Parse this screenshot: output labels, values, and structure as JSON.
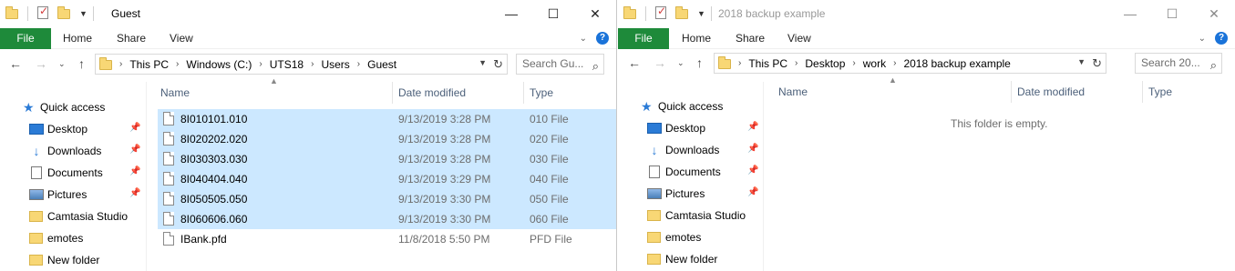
{
  "left_window": {
    "title": "Guest",
    "controls": {
      "minimize": "—",
      "maximize": "☐",
      "close": "✕"
    },
    "ribbon_tabs": [
      "File",
      "Home",
      "Share",
      "View"
    ],
    "address": {
      "crumbs": [
        "This PC",
        "Windows (C:)",
        "UTS18",
        "Users",
        "Guest"
      ]
    },
    "search_placeholder": "Search Gu...",
    "nav": {
      "quick_access": "Quick access",
      "items": [
        {
          "label": "Desktop",
          "icon": "desktop-icon",
          "pinned": true
        },
        {
          "label": "Downloads",
          "icon": "downloads-icon",
          "pinned": true
        },
        {
          "label": "Documents",
          "icon": "documents-icon",
          "pinned": true
        },
        {
          "label": "Pictures",
          "icon": "pictures-icon",
          "pinned": true
        },
        {
          "label": "Camtasia Studio",
          "icon": "folder-icon",
          "pinned": false
        },
        {
          "label": "emotes",
          "icon": "folder-icon",
          "pinned": false
        },
        {
          "label": "New folder",
          "icon": "folder-icon",
          "pinned": false
        }
      ]
    },
    "columns": {
      "name": "Name",
      "date": "Date modified",
      "type": "Type"
    },
    "files": [
      {
        "name": "8I010101.010",
        "date": "9/13/2019 3:28 PM",
        "type": "010 File",
        "selected": true
      },
      {
        "name": "8I020202.020",
        "date": "9/13/2019 3:28 PM",
        "type": "020 File",
        "selected": true
      },
      {
        "name": "8I030303.030",
        "date": "9/13/2019 3:28 PM",
        "type": "030 File",
        "selected": true
      },
      {
        "name": "8I040404.040",
        "date": "9/13/2019 3:29 PM",
        "type": "040 File",
        "selected": true
      },
      {
        "name": "8I050505.050",
        "date": "9/13/2019 3:30 PM",
        "type": "050 File",
        "selected": true
      },
      {
        "name": "8I060606.060",
        "date": "9/13/2019 3:30 PM",
        "type": "060 File",
        "selected": true
      },
      {
        "name": "IBank.pfd",
        "date": "11/8/2018 5:50 PM",
        "type": "PFD File",
        "selected": false
      }
    ]
  },
  "right_window": {
    "title": "2018 backup example",
    "controls": {
      "minimize": "—",
      "maximize": "☐",
      "close": "✕"
    },
    "ribbon_tabs": [
      "File",
      "Home",
      "Share",
      "View"
    ],
    "address": {
      "crumbs": [
        "This PC",
        "Desktop",
        "work",
        "2018 backup example"
      ]
    },
    "search_placeholder": "Search 20...",
    "nav": {
      "quick_access": "Quick access",
      "items": [
        {
          "label": "Desktop",
          "icon": "desktop-icon",
          "pinned": true
        },
        {
          "label": "Downloads",
          "icon": "downloads-icon",
          "pinned": true
        },
        {
          "label": "Documents",
          "icon": "documents-icon",
          "pinned": true
        },
        {
          "label": "Pictures",
          "icon": "pictures-icon",
          "pinned": true
        },
        {
          "label": "Camtasia Studio",
          "icon": "folder-icon",
          "pinned": false
        },
        {
          "label": "emotes",
          "icon": "folder-icon",
          "pinned": false
        },
        {
          "label": "New folder",
          "icon": "folder-icon",
          "pinned": false
        }
      ]
    },
    "columns": {
      "name": "Name",
      "date": "Date modified",
      "type": "Type"
    },
    "empty_message": "This folder is empty."
  },
  "colors": {
    "file_tab": "#1e8a3a",
    "selection": "#cce8ff",
    "header_text": "#4c607a",
    "folder": "#f8d775"
  }
}
